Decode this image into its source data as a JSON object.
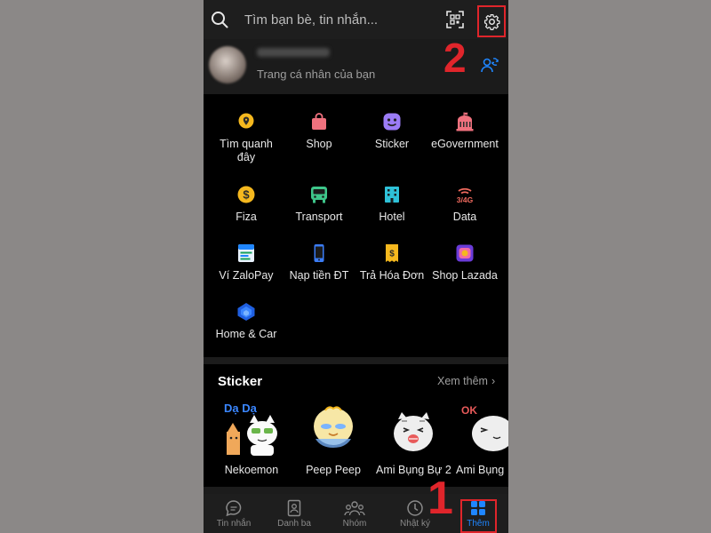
{
  "search": {
    "placeholder": "Tìm bạn bè, tin nhắn..."
  },
  "profile": {
    "subtitle": "Trang cá nhân của bạn"
  },
  "annotations": {
    "step1": "1",
    "step2": "2"
  },
  "grid": {
    "items": [
      {
        "label": "Tìm quanh\nđây",
        "icon": "location-pin-icon"
      },
      {
        "label": "Shop",
        "icon": "shopping-bag-icon"
      },
      {
        "label": "Sticker",
        "icon": "sticker-face-icon"
      },
      {
        "label": "eGovernment",
        "icon": "government-building-icon"
      },
      {
        "label": "Fiza",
        "icon": "dollar-coin-icon"
      },
      {
        "label": "Transport",
        "icon": "bus-icon"
      },
      {
        "label": "Hotel",
        "icon": "hotel-icon"
      },
      {
        "label": "Data",
        "icon": "mobile-data-icon"
      },
      {
        "label": "Ví ZaloPay",
        "icon": "zalopay-icon"
      },
      {
        "label": "Nạp tiền ĐT",
        "icon": "phone-topup-icon"
      },
      {
        "label": "Trả Hóa Đơn",
        "icon": "bill-icon"
      },
      {
        "label": "Shop Lazada",
        "icon": "lazada-icon"
      },
      {
        "label": "Home & Car",
        "icon": "home-car-icon"
      }
    ]
  },
  "icon_text": {
    "data": "3/4G"
  },
  "stickers": {
    "title": "Sticker",
    "more": "Xem thêm",
    "items": [
      {
        "label": "Nekoemon",
        "sticker_text": "Dạ Dạ"
      },
      {
        "label": "Peep Peep"
      },
      {
        "label": "Ami Bụng Bự 2"
      },
      {
        "label": "Ami Bụng",
        "sticker_text": "OK"
      }
    ]
  },
  "tabs": [
    {
      "label": "Tin nhắn",
      "icon": "chat-bubble-icon"
    },
    {
      "label": "Danh ba",
      "icon": "contacts-icon"
    },
    {
      "label": "Nhóm",
      "icon": "group-icon"
    },
    {
      "label": "Nhật ký",
      "icon": "clock-icon"
    },
    {
      "label": "Thêm",
      "icon": "grid-icon",
      "active": true
    }
  ],
  "colors": {
    "accent": "#1f86ff",
    "annotation_red": "#e0252b",
    "background": "#000000"
  }
}
